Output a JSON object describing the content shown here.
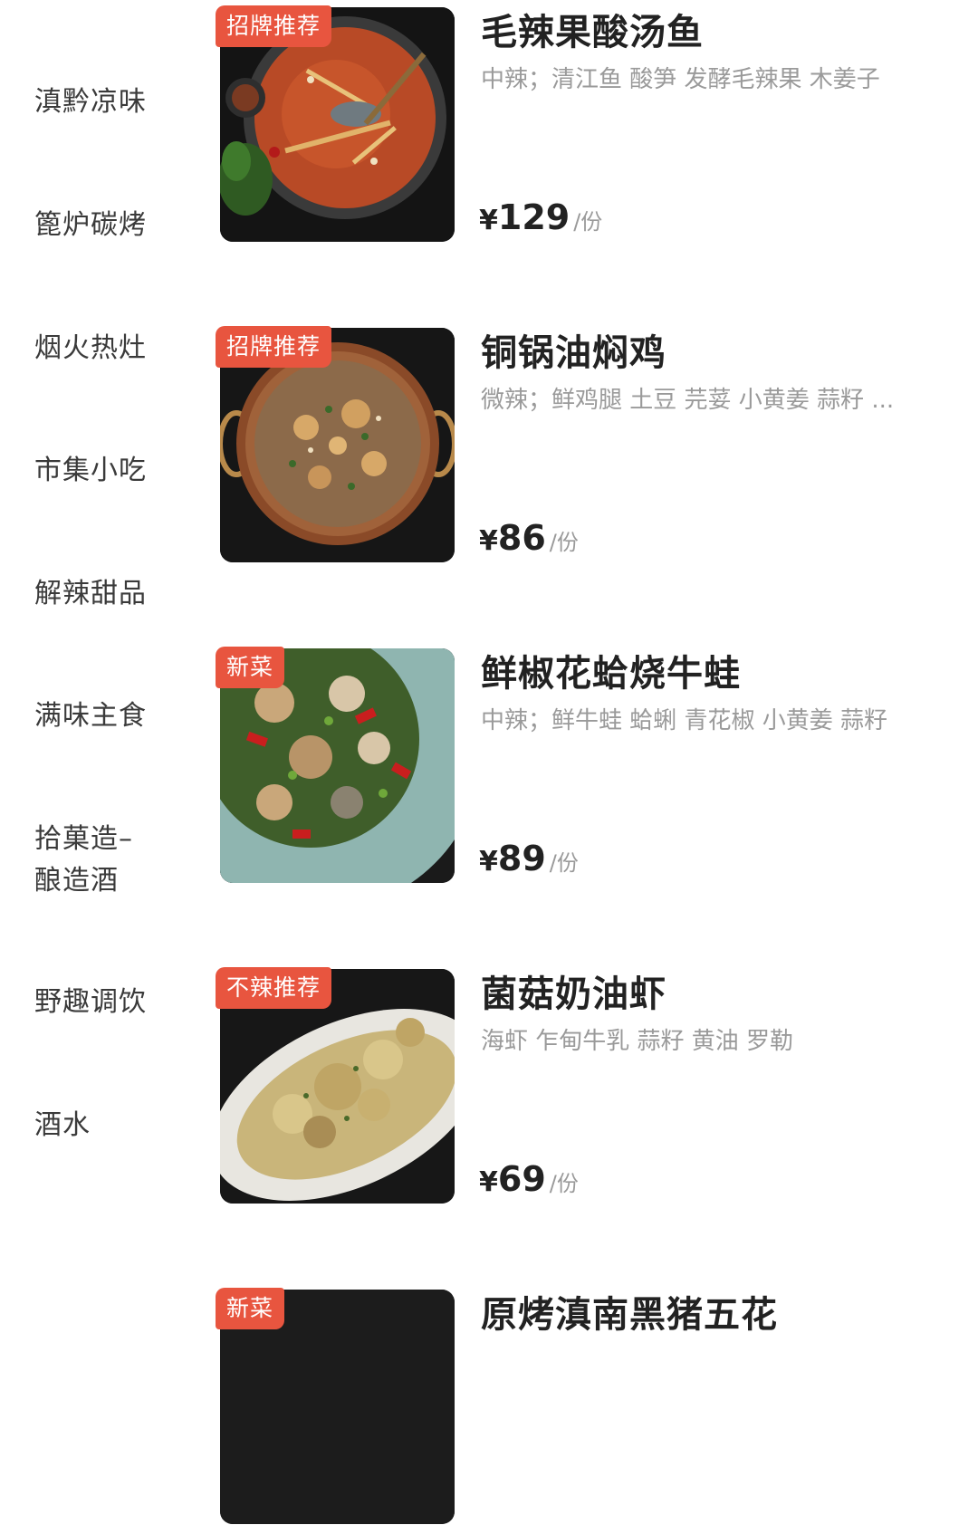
{
  "sidebar": {
    "items": [
      {
        "label": "滇黔凉味"
      },
      {
        "label": "篦炉碳烤"
      },
      {
        "label": "烟火热灶"
      },
      {
        "label": "市集小吃"
      },
      {
        "label": "解辣甜品"
      },
      {
        "label": "满味主食"
      },
      {
        "label": "拾菓造–\n酿造酒"
      },
      {
        "label": "野趣调饮"
      },
      {
        "label": "酒水"
      }
    ]
  },
  "dishes": [
    {
      "badge": "招牌推荐",
      "name": "毛辣果酸汤鱼",
      "desc": "中辣；清江鱼 酸笋 发酵毛辣果 木姜子",
      "currency": "¥",
      "price": "129",
      "unit": "/份",
      "image_icon": "sour-soup-fish-photo"
    },
    {
      "badge": "招牌推荐",
      "name": "铜锅油焖鸡",
      "desc": "微辣；鲜鸡腿 土豆 芫荽 小黄姜 蒜籽 ...",
      "currency": "¥",
      "price": "86",
      "unit": "/份",
      "image_icon": "copper-pot-chicken-photo"
    },
    {
      "badge": "新菜",
      "name": "鲜椒花蛤烧牛蛙",
      "desc": "中辣；鲜牛蛙 蛤蜊 青花椒 小黄姜 蒜籽",
      "currency": "¥",
      "price": "89",
      "unit": "/份",
      "image_icon": "bullfrog-clam-photo"
    },
    {
      "badge": "不辣推荐",
      "name": "菌菇奶油虾",
      "desc": "海虾 乍甸牛乳 蒜籽 黄油 罗勒",
      "currency": "¥",
      "price": "69",
      "unit": "/份",
      "image_icon": "mushroom-cream-shrimp-photo"
    },
    {
      "badge": "新菜",
      "name": "原烤滇南黑猪五花",
      "desc": "",
      "currency": "",
      "price": "",
      "unit": "",
      "image_icon": "grilled-pork-belly-photo"
    }
  ],
  "colors": {
    "badge_bg": "#e8553f",
    "text_primary": "#222222",
    "text_secondary": "#9a9a9a"
  }
}
